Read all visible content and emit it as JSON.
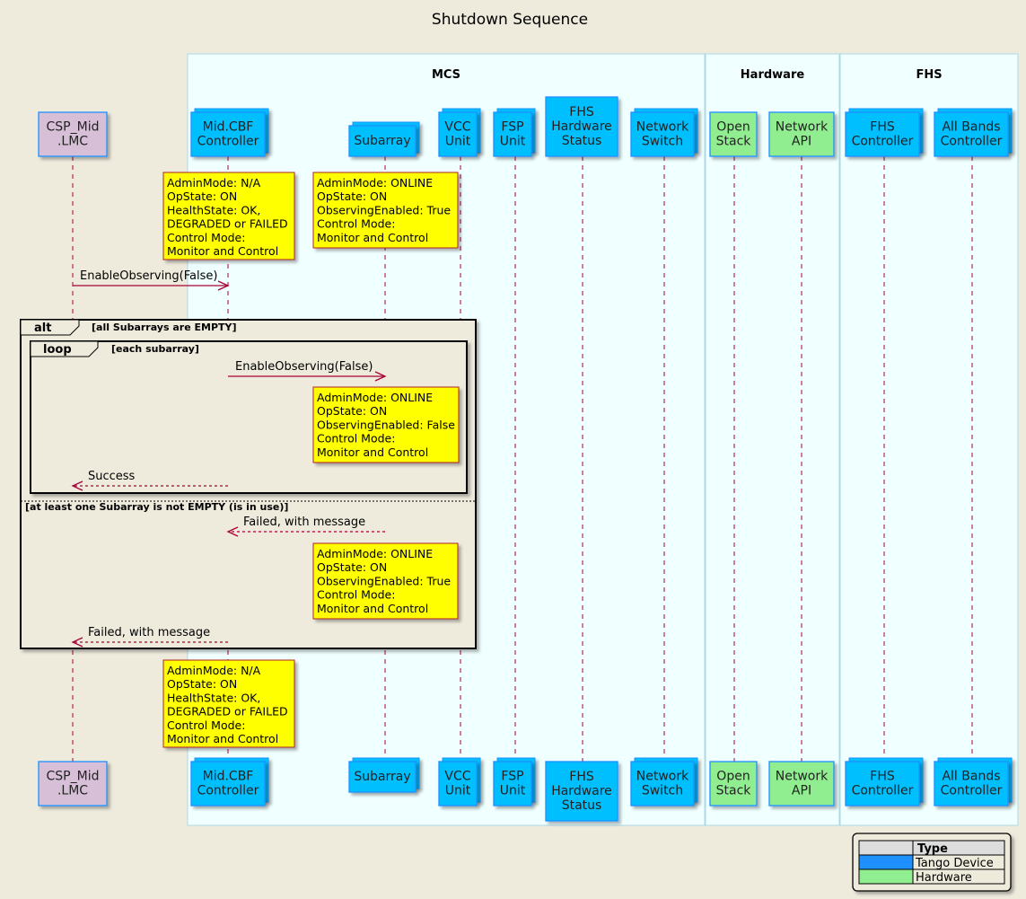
{
  "title": "Shutdown Sequence",
  "colors": {
    "background": "#EEEBDD",
    "box_fill": "#F0FFFF",
    "box_border": "#ADD8E6",
    "lmc_fill": "#D8BFD8",
    "tango_fill": "#00BFFF",
    "hardware_fill": "#90EE90",
    "participant_border": "#1E90FF",
    "note_fill": "#FFFF00",
    "note_border": "#B22222",
    "arrow": "#A80036",
    "legend_tango": "#1E90FF",
    "legend_hardware": "#90EE90"
  },
  "boxes": [
    {
      "id": "mcs",
      "title": "MCS"
    },
    {
      "id": "hardware",
      "title": "Hardware"
    },
    {
      "id": "fhs",
      "title": "FHS"
    }
  ],
  "participants": [
    {
      "id": "lmc",
      "lines": [
        "CSP_Mid",
        ".LMC"
      ],
      "kind": "lmc",
      "stack": false
    },
    {
      "id": "controller",
      "lines": [
        "Mid.CBF",
        "Controller"
      ],
      "kind": "tango",
      "stack": true
    },
    {
      "id": "subarray",
      "lines": [
        "Subarray"
      ],
      "kind": "tango",
      "stack": true
    },
    {
      "id": "vcc",
      "lines": [
        "VCC",
        "Unit"
      ],
      "kind": "tango",
      "stack": true
    },
    {
      "id": "fsp",
      "lines": [
        "FSP",
        "Unit"
      ],
      "kind": "tango",
      "stack": true
    },
    {
      "id": "fhs_status",
      "lines": [
        "FHS",
        "Hardware",
        "Status"
      ],
      "kind": "tango",
      "stack": false
    },
    {
      "id": "switch",
      "lines": [
        "Network",
        "Switch"
      ],
      "kind": "tango",
      "stack": true
    },
    {
      "id": "openstack",
      "lines": [
        "Open",
        "Stack"
      ],
      "kind": "hardware",
      "stack": false
    },
    {
      "id": "netapi",
      "lines": [
        "Network",
        "API"
      ],
      "kind": "hardware",
      "stack": false
    },
    {
      "id": "fhs_controller",
      "lines": [
        "FHS",
        "Controller"
      ],
      "kind": "tango",
      "stack": true
    },
    {
      "id": "bands",
      "lines": [
        "All Bands",
        "Controller"
      ],
      "kind": "tango",
      "stack": true
    }
  ],
  "notes": [
    {
      "id": "note-controller-1",
      "lines": [
        "AdminMode: N/A",
        "OpState: ON",
        "HealthState: OK,",
        "DEGRADED or FAILED",
        "Control Mode:",
        "Monitor and Control"
      ]
    },
    {
      "id": "note-subarray-1",
      "lines": [
        "AdminMode: ONLINE",
        "OpState: ON",
        "ObservingEnabled: True",
        "Control Mode:",
        "Monitor and Control"
      ]
    },
    {
      "id": "note-subarray-2",
      "lines": [
        "AdminMode: ONLINE",
        "OpState: ON",
        "ObservingEnabled: False",
        "Control Mode:",
        "Monitor and Control"
      ]
    },
    {
      "id": "note-subarray-3",
      "lines": [
        "AdminMode: ONLINE",
        "OpState: ON",
        "ObservingEnabled: True",
        "Control Mode:",
        "Monitor and Control"
      ]
    },
    {
      "id": "note-controller-2",
      "lines": [
        "AdminMode: N/A",
        "OpState: ON",
        "HealthState: OK,",
        "DEGRADED or FAILED",
        "Control Mode:",
        "Monitor and Control"
      ]
    }
  ],
  "messages": [
    {
      "id": "msg-1",
      "label": "EnableObserving(False)",
      "from": "lmc",
      "to": "controller",
      "dashed": false
    },
    {
      "id": "msg-2",
      "label": "EnableObserving(False)",
      "from": "controller",
      "to": "subarray",
      "dashed": false
    },
    {
      "id": "msg-3",
      "label": "Success",
      "from": "controller",
      "to": "lmc",
      "dashed": true
    },
    {
      "id": "msg-4",
      "label": "Failed, with message",
      "from": "subarray",
      "to": "controller",
      "dashed": true
    },
    {
      "id": "msg-5",
      "label": "Failed, with message",
      "from": "controller",
      "to": "lmc",
      "dashed": true
    }
  ],
  "fragments": {
    "alt": {
      "keyword": "alt",
      "guard": "[all Subarrays are EMPTY]",
      "else_guard": "[at least one Subarray is not EMPTY (is in use)]"
    },
    "loop": {
      "keyword": "loop",
      "guard": "[each subarray]"
    }
  },
  "legend": {
    "header": "Type",
    "rows": [
      {
        "label": "Tango Device",
        "color": "#1E90FF"
      },
      {
        "label": "Hardware",
        "color": "#90EE90"
      }
    ]
  }
}
